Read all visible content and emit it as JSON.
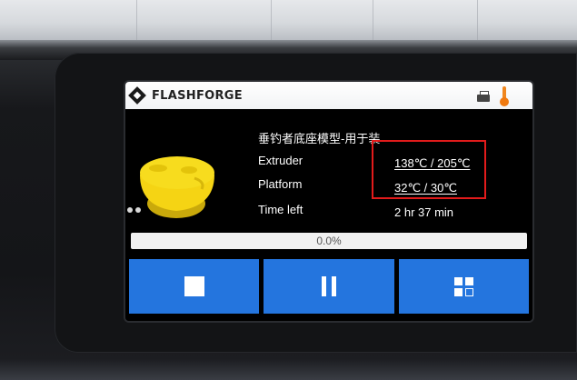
{
  "header": {
    "brand": "FLASHFORGE",
    "icons": [
      "printer-icon",
      "thermometer-icon"
    ],
    "thermo_color": "#f07a10"
  },
  "job": {
    "file_name": "垂钓者底座模型-用于装",
    "rows": [
      {
        "label": "Extruder",
        "value": "138℃ / 205℃"
      },
      {
        "label": "Platform",
        "value": "32℃ / 30℃"
      },
      {
        "label": "Time left",
        "value": "2 hr 37 min"
      }
    ]
  },
  "progress": {
    "text": "0.0%",
    "fraction": 0.0,
    "fill_color": "#2f7de0"
  },
  "buttons": {
    "stop_icon": "stop-icon",
    "pause_icon": "pause-icon",
    "more_icon": "menu-grid-icon",
    "color": "#2475de"
  },
  "annotation": {
    "highlight_color": "#e21b1b"
  },
  "model_color": "#f5d414"
}
